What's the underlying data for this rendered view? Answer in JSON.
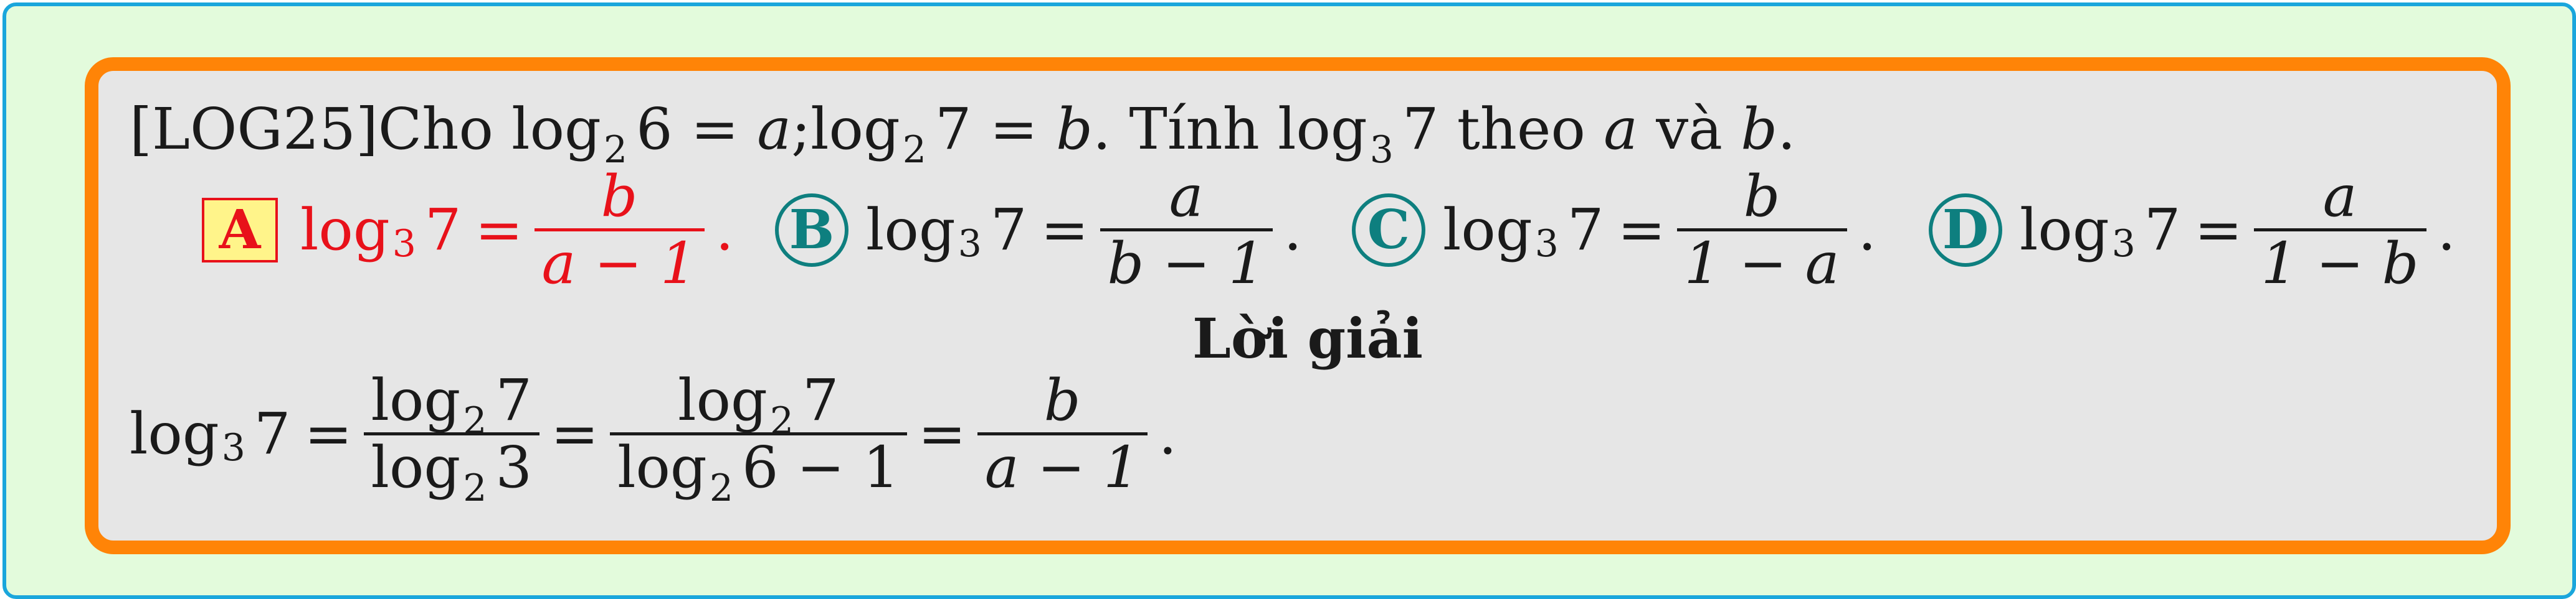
{
  "question": {
    "tag": "[LOG25]",
    "text_cho": "Cho",
    "log": "log",
    "base_2": "2",
    "base_3": "3",
    "six": "6",
    "seven": "7",
    "eq": "=",
    "a": "a",
    "b": "b",
    "semicolon": ";",
    "period": ".",
    "text_tinh": "Tính",
    "text_theo": "theo",
    "text_va": "và"
  },
  "options": [
    {
      "letter": "A",
      "num": "b",
      "den": "a − 1",
      "correct": true
    },
    {
      "letter": "B",
      "num": "a",
      "den": "b − 1",
      "correct": false
    },
    {
      "letter": "C",
      "num": "b",
      "den": "1 − a",
      "correct": false
    },
    {
      "letter": "D",
      "num": "a",
      "den": "1 − b",
      "correct": false
    }
  ],
  "solution": {
    "heading": "Lời giải",
    "frac1_den_tail": "3",
    "frac2_den_tail": "6 − 1",
    "frac3_num": "b",
    "frac3_den": "a − 1"
  },
  "colors": {
    "outer_bg": "#e3fbdc",
    "outer_border": "#1aa6dc",
    "card_bg": "#e6e6e6",
    "card_border": "#ff8407",
    "correct": "#e8111a",
    "option": "#0e7f7f",
    "highlight": "#fff48a"
  }
}
